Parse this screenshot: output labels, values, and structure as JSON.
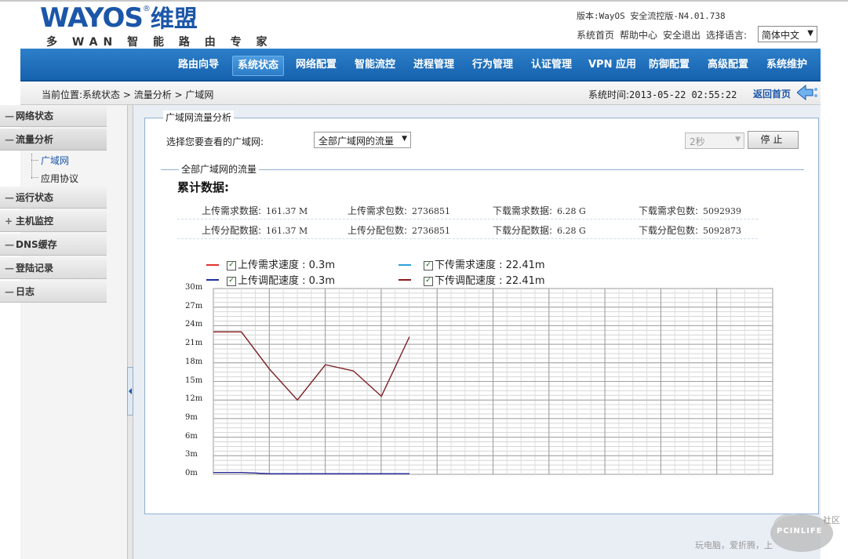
{
  "header": {
    "logo_text": "WAYOS",
    "logo_reg": "®",
    "logo_cn": "维盟",
    "slogan": "多 WAN 智 能 路 由 专 家",
    "version": "版本:WayOS 安全流控版-N4.01.738",
    "links": [
      "系统首页",
      "帮助中心",
      "安全退出",
      "选择语言:"
    ],
    "language": "简体中文"
  },
  "nav": {
    "items": [
      "路由向导",
      "系统状态",
      "网络配置",
      "智能流控",
      "进程管理",
      "行为管理",
      "认证管理",
      "VPN 应用",
      "防御配置",
      "高级配置",
      "系统维护"
    ],
    "active": "系统状态"
  },
  "breadcrumb": {
    "text": "当前位置:系统状态 > 流量分析 > 广域网",
    "systime_label": "系统时间:",
    "systime": "2013-05-22 02:55:22",
    "home": "返回首页"
  },
  "sidebar": {
    "items": [
      {
        "sym": "—",
        "label": "网络状态"
      },
      {
        "sym": "—",
        "label": "流量分析"
      },
      {
        "sym": "—",
        "label": "运行状态"
      },
      {
        "sym": "+",
        "label": "主机监控"
      },
      {
        "sym": "—",
        "label": "DNS缓存"
      },
      {
        "sym": "—",
        "label": "登陆记录"
      },
      {
        "sym": "—",
        "label": "日志"
      }
    ],
    "subitems": [
      "广域网",
      "应用协议"
    ]
  },
  "panel": {
    "legend": "广域网流量分析",
    "pick_label": "选择您要查看的广域网:",
    "wan_value": "全部广域网的流量",
    "interval": "2秒",
    "stop": "停止",
    "sub_legend": "全部广域网的流量",
    "stats_title": "累计数据:"
  },
  "stats": {
    "row1": [
      {
        "label": "上传需求数据:",
        "value": "161.37 M"
      },
      {
        "label": "上传需求包数:",
        "value": "2736851"
      },
      {
        "label": "下载需求数据:",
        "value": "6.28 G"
      },
      {
        "label": "下载需求包数:",
        "value": "5092939"
      }
    ],
    "row2": [
      {
        "label": "上传分配数据:",
        "value": "161.37 M"
      },
      {
        "label": "上传分配包数:",
        "value": "2736851"
      },
      {
        "label": "下载分配数据:",
        "value": "6.28 G"
      },
      {
        "label": "下载分配包数:",
        "value": "5092873"
      }
    ]
  },
  "chart_data": {
    "type": "line",
    "ylim": [
      0,
      30
    ],
    "yticks": [
      "30m",
      "27m",
      "24m",
      "21m",
      "18m",
      "15m",
      "12m",
      "9m",
      "6m",
      "3m",
      "0m"
    ],
    "series": [
      {
        "name": "上传需求速度 : 0.3m",
        "color": "#e03030",
        "values": [
          0.3,
          0.3,
          0.1,
          0.1,
          0.1,
          0.1,
          0.1,
          0.1
        ]
      },
      {
        "name": "下传需求速度 : 22.41m",
        "color": "#2aa3d6",
        "values": [
          23,
          23,
          17,
          12,
          17.7,
          16.7,
          12.6,
          22.2
        ]
      },
      {
        "name": "上传调配速度 : 0.3m",
        "color": "#1c2fa0",
        "values": [
          0.3,
          0.3,
          0.1,
          0.1,
          0.1,
          0.1,
          0.1,
          0.1
        ]
      },
      {
        "name": "下传调配速度 : 22.41m",
        "color": "#8b1a1a",
        "values": [
          23,
          23,
          17,
          12,
          17.7,
          16.7,
          12.6,
          22.2
        ]
      }
    ]
  },
  "watermark": {
    "slogan": "玩电脑，爱折腾，上",
    "brand": "PCINLIFE",
    "corner": "社区"
  }
}
